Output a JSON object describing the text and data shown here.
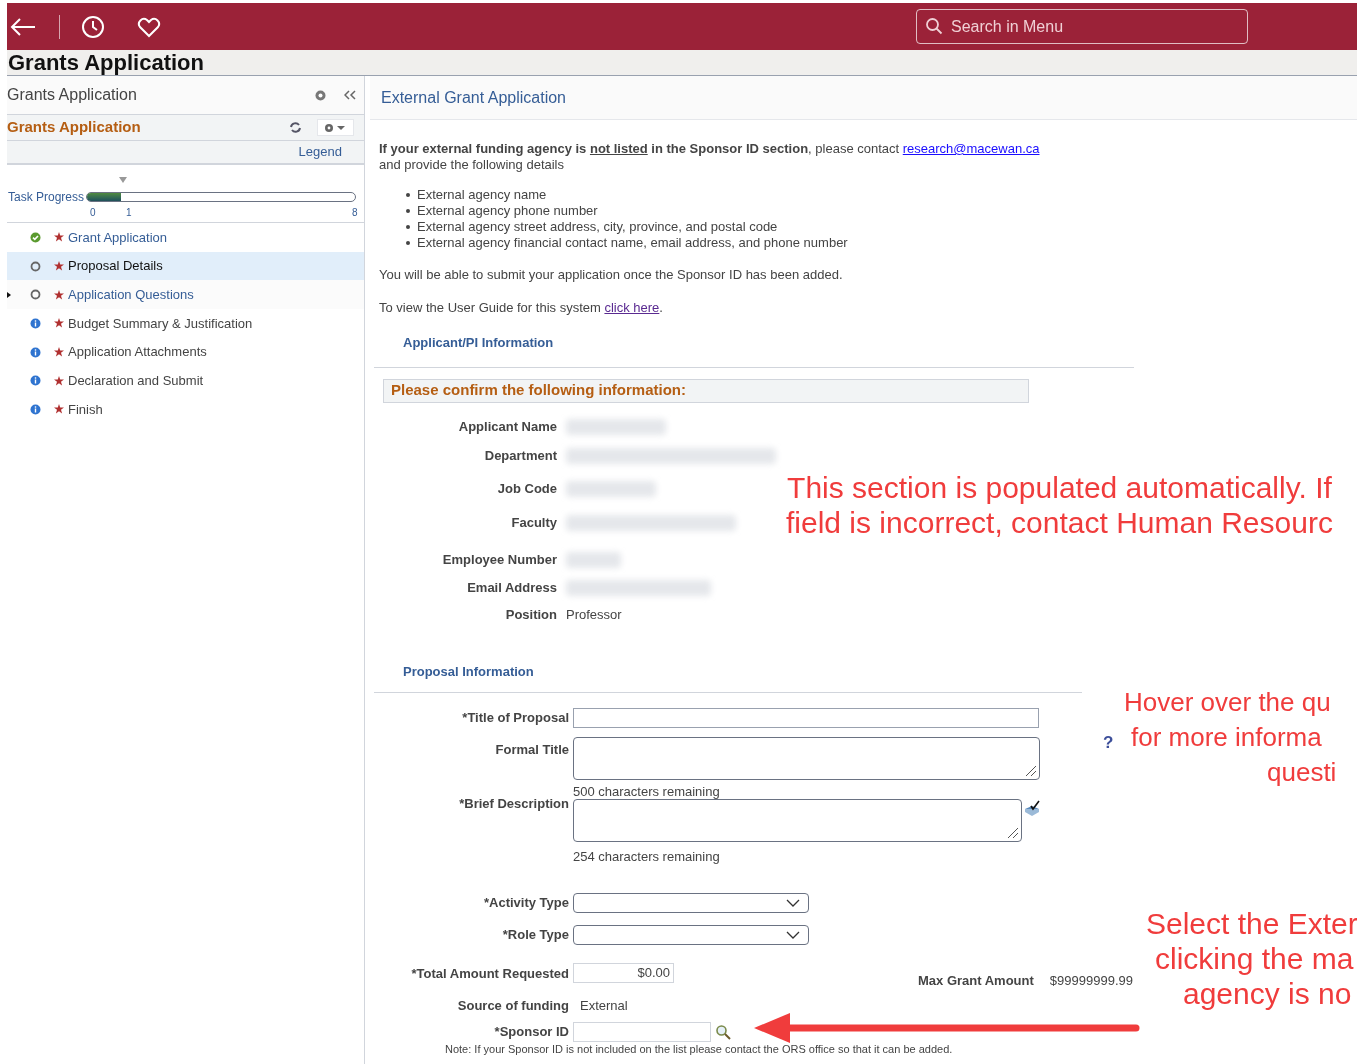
{
  "top_bar": {
    "search": {
      "placeholder": "Search in Menu"
    }
  },
  "page_title": "Grants Application",
  "sidebar": {
    "title": "Grants Application",
    "section_title": "Grants Application",
    "legend": "Legend",
    "progress": {
      "label": "Task Progress",
      "level": 0.125,
      "ticks": [
        "0",
        "1",
        "8"
      ]
    },
    "steps": [
      {
        "label": "Grant Application",
        "kind": "complete",
        "selected": false,
        "expandable": false
      },
      {
        "label": "Proposal Details",
        "kind": "pending",
        "selected": true,
        "expandable": false
      },
      {
        "label": "Application Questions",
        "kind": "pending",
        "selected": false,
        "expandable": true
      },
      {
        "label": "Budget Summary & Justification",
        "kind": "info",
        "selected": false,
        "expandable": false
      },
      {
        "label": "Application Attachments",
        "kind": "info",
        "selected": false,
        "expandable": false
      },
      {
        "label": "Declaration and Submit",
        "kind": "info",
        "selected": false,
        "expandable": false
      },
      {
        "label": "Finish",
        "kind": "info",
        "selected": false,
        "expandable": false
      }
    ]
  },
  "content": {
    "title": "External Grant Application",
    "intro": [
      {
        "kind": "bold",
        "text": "If your external funding agency is "
      },
      {
        "kind": "bold-underline",
        "text": "not listed"
      },
      {
        "kind": "bold",
        "text": " in the Sponsor ID section"
      },
      {
        "kind": "plain",
        "text": ", please contact "
      },
      {
        "kind": "link",
        "text": "research@macewan.ca"
      },
      {
        "kind": "break"
      },
      {
        "kind": "plain",
        "text": "and provide the following details"
      }
    ],
    "bullets": [
      "External agency name",
      "External agency phone number",
      "External agency street address, city, province, and postal code",
      "External agency financial contact name, email address, and phone number"
    ],
    "submit_note": "You will be able to submit your application once the Sponsor ID has been added.",
    "guide": {
      "text": "To view the User Guide for this system ",
      "link": "click here",
      "end": "."
    },
    "applicant": {
      "heading": "Applicant/PI Information",
      "confirm": "Please confirm the following information:",
      "fields": [
        {
          "label": "Applicant Name",
          "kind": "redacted"
        },
        {
          "label": "Department",
          "kind": "redacted"
        },
        {
          "label": "Job Code",
          "kind": "redacted"
        },
        {
          "label": "Faculty",
          "kind": "redacted"
        },
        {
          "label": "Employee Number",
          "kind": "redacted"
        },
        {
          "label": "Email Address",
          "kind": "redacted"
        },
        {
          "label": "Position",
          "kind": "text",
          "value": "Professor"
        }
      ]
    },
    "proposal": {
      "heading": "Proposal Information",
      "title_label": "*Title of Proposal",
      "formal_label": "Formal Title",
      "formal_remaining": "500 characters remaining",
      "brief_label": "*Brief Description",
      "brief_remaining": "254 characters remaining",
      "activity_label": "*Activity Type",
      "role_label": "*Role Type",
      "amount_label": "*Total Amount Requested",
      "amount_value": "$0.00",
      "max_label": "Max Grant Amount",
      "max_value": "$99999999.99",
      "source_label": "Source of funding",
      "source_value": "External",
      "sponsor_label": "*Sponsor ID",
      "note": "Note: If your Sponsor ID is not included on the list please contact the ORS office so that it can be added."
    }
  },
  "annotations": [
    {
      "lines": [
        "This section is populated automatically. If",
        "field is incorrect, contact Human Resourc"
      ]
    },
    {
      "help": "?",
      "lines": [
        "Hover over the qu",
        "for more informa",
        "questi"
      ]
    },
    {
      "lines": [
        "Select the Exter",
        "clicking the ma",
        "agency is no"
      ]
    }
  ]
}
